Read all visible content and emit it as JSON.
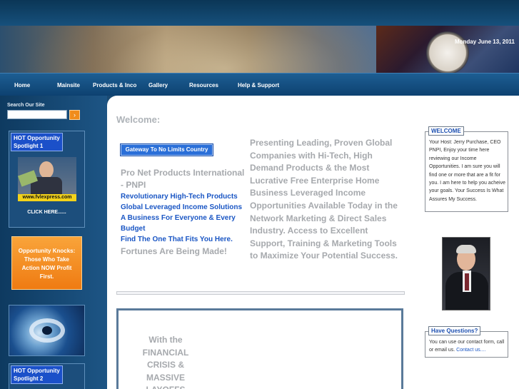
{
  "header": {
    "date": "Monday June 13, 2011"
  },
  "nav": {
    "items": [
      {
        "label": "Home"
      },
      {
        "label": "Mainsite"
      },
      {
        "label": "Products & Inco"
      },
      {
        "label": "Gallery"
      },
      {
        "label": "Resources"
      },
      {
        "label": "Help & Support"
      }
    ]
  },
  "sidebar": {
    "search_label": "Search Our Site",
    "search_value": "",
    "search_button": "›",
    "spotlight1": {
      "title_line1": "HOT Opportunity",
      "title_line2": "Spotlight 1",
      "url": "www.fvlexpress.com",
      "click_here": "CLICK HERE......"
    },
    "opportunity": {
      "text": "Opportunity Knocks: Those Who Take Action NOW Profit First."
    },
    "spotlight2": {
      "title_line1": "HOT Opportunity",
      "title_line2": "Spotlight 2"
    }
  },
  "main": {
    "welcome": "Welcome:",
    "gateway_button": "Gateway To No Limits Country",
    "pnpi": "Pro Net Products International - PNPI",
    "blue_lines": [
      "Revolutionary High-Tech Products",
      "Global Leveraged Income Solutions",
      "A Business For Everyone & Every Budget",
      "Find The One That Fits You Here."
    ],
    "fortunes": "Fortunes Are Being Made!",
    "presenting": "Presenting Leading, Proven Global Companies with Hi-Tech, High Demand Products & the Most Lucrative Free Enterprise Home Business Leveraged Income Opportunities Available Today in the Network Marketing & Direct Sales Industry.  Access to Excellent Support, Training & Marketing Tools to Maximize Your Potential Success.",
    "framed_text": "With the FINANCIAL CRISIS & MASSIVE LAYOFFS"
  },
  "right": {
    "welcome_title": "WELCOME",
    "welcome_text": "Your Host: Jerry Purchase, CEO PNPI, Enjoy your time here reviewing our Income Opportunities. I am sure you will find one or more that are a fit for you. I am here to help you acheive your goals. Your Success Is What Assures My Success.",
    "questions_title": "Have Questions?",
    "questions_text": "You can use our contact form, call or email us.",
    "contact_link": "Contact us...."
  }
}
